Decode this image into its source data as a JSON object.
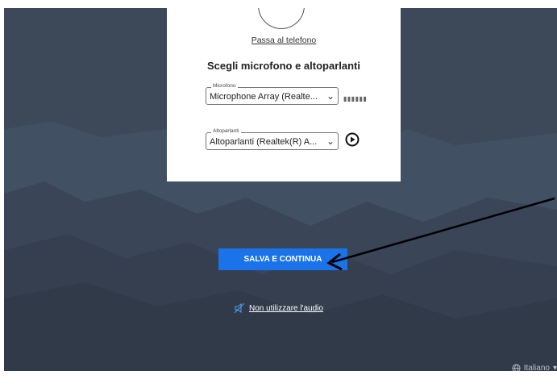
{
  "card": {
    "phone_link": "Passa al telefono",
    "title": "Scegli microfono e altoparlanti",
    "microphone": {
      "legend": "Microfono",
      "value": "Microphone Array (Realte..."
    },
    "speakers": {
      "legend": "Altoparlanti",
      "value": "Altoparlanti (Realtek(R) A..."
    }
  },
  "actions": {
    "save_label": "SALVA E CONTINUA",
    "no_audio_label": "Non utilizzare l'audio"
  },
  "footer": {
    "language": "Italiano"
  },
  "colors": {
    "background": "#3e4a5a",
    "primary": "#1a73e8"
  },
  "icons": [
    "mic-level-meter",
    "play-icon",
    "no-audio-icon",
    "globe-icon",
    "chevron-down-icon"
  ]
}
